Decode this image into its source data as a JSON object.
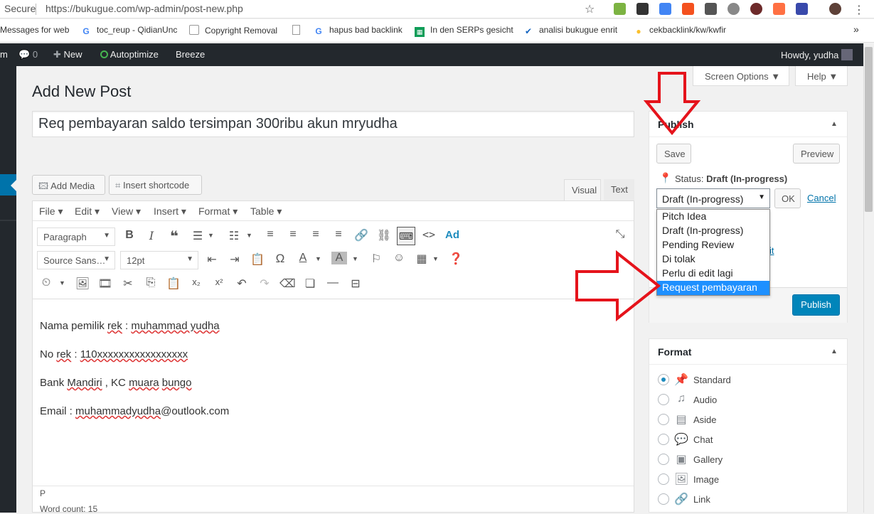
{
  "browser": {
    "secure_label": "Secure",
    "url": "https://bukugue.com/wp-admin/post-new.php",
    "bookmarks": [
      "Messages for web",
      "toc_reup - QidianUnc",
      "Copyright Removal",
      "",
      "hapus bad backlink",
      "In den SERPs gesicht",
      "analisi bukugue enrit",
      "cekbacklink/kw/kwfir"
    ],
    "more": "»"
  },
  "adminbar": {
    "site_initial": "m",
    "comments_count": "0",
    "new_label": "New",
    "autoptimize_label": "Autoptimize",
    "breeze_label": "Breeze",
    "howdy": "Howdy, yudha"
  },
  "screen_options": "Screen Options ▼",
  "help": "Help ▼",
  "page_title": "Add New Post",
  "post_title": "Req pembayaran saldo tersimpan 300ribu akun mryudha",
  "add_media": "Add Media",
  "insert_shortcode": "Insert shortcode",
  "tabs": {
    "visual": "Visual",
    "text": "Text"
  },
  "menus": [
    "File ▾",
    "Edit ▾",
    "View ▾",
    "Insert ▾",
    "Format ▾",
    "Table ▾"
  ],
  "toolbar": {
    "paragraph": "Paragraph",
    "font": "Source Sans…",
    "size": "12pt"
  },
  "content": {
    "line1_a": "Nama pemilik ",
    "line1_b": "rek",
    "line1_c": " : ",
    "line1_d": "muhammad yudha",
    "line2_a": "No ",
    "line2_b": "rek",
    "line2_c": " : ",
    "line2_d": "110xxxxxxxxxxxxxxxxx",
    "line3_a": "Bank ",
    "line3_b": "Mandiri",
    "line3_c": " , KC ",
    "line3_d": "muara",
    "line3_e": " ",
    "line3_f": "bungo",
    "line4_a": "Email : ",
    "line4_b": "muhammadyudha",
    "line4_c": "@outlook.com"
  },
  "path": "P",
  "word_count": "Word count: 15",
  "publish": {
    "title": "Publish",
    "save": "Save",
    "preview": "Preview",
    "status_label": "Status:",
    "status_value": "Draft (In-progress)",
    "select_value": "Draft (In-progress)",
    "ok": "OK",
    "cancel": "Cancel",
    "partial_link": "it",
    "publish_btn": "Publish",
    "options": [
      "Pitch Idea",
      "Draft (In-progress)",
      "Pending Review",
      "Di tolak",
      "Perlu di edit lagi",
      "Request pembayaran"
    ],
    "selected_index": 5
  },
  "format": {
    "title": "Format",
    "options": [
      {
        "label": "Standard",
        "icon": "pin-icon",
        "checked": true
      },
      {
        "label": "Audio",
        "icon": "music-note-icon",
        "checked": false
      },
      {
        "label": "Aside",
        "icon": "aside-icon",
        "checked": false
      },
      {
        "label": "Chat",
        "icon": "chat-bubbles-icon",
        "checked": false
      },
      {
        "label": "Gallery",
        "icon": "gallery-icon",
        "checked": false
      },
      {
        "label": "Image",
        "icon": "image-icon",
        "checked": false
      },
      {
        "label": "Link",
        "icon": "link-icon",
        "checked": false
      }
    ]
  },
  "colors": {
    "accent": "#0073aa",
    "publish": "#0085ba",
    "arrow": "#e5131b"
  }
}
